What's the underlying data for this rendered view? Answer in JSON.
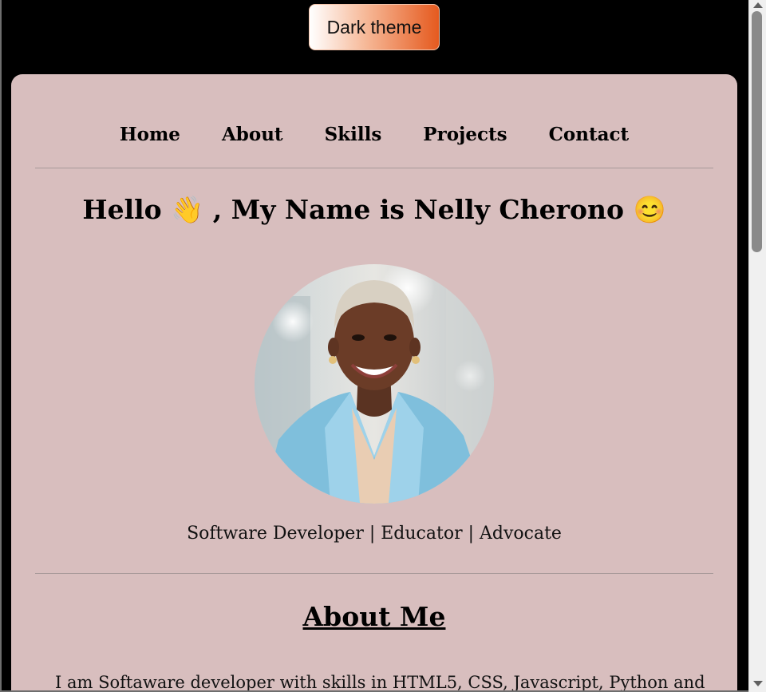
{
  "theme_toggle": {
    "label": "Dark theme"
  },
  "nav": {
    "items": [
      {
        "label": "Home"
      },
      {
        "label": "About"
      },
      {
        "label": "Skills"
      },
      {
        "label": "Projects"
      },
      {
        "label": "Contact"
      }
    ]
  },
  "hero": {
    "greeting_before": "Hello ",
    "wave_emoji": "👋",
    "greeting_after": " , My Name is Nelly Cherono ",
    "smile_emoji": "😊",
    "tagline": "Software Developer | Educator | Advocate"
  },
  "about": {
    "title": "About Me",
    "text": "I am Softaware developer with skills in HTML5, CSS, Javascript, Python and"
  },
  "colors": {
    "page_background": "#000000",
    "card_background": "#d8bebe",
    "button_gradient_start": "#ffffff",
    "button_gradient_end": "#e55a1f"
  },
  "icons": {
    "scroll_up": "scroll-up-arrow-icon",
    "scroll_down": "scroll-down-arrow-icon"
  }
}
